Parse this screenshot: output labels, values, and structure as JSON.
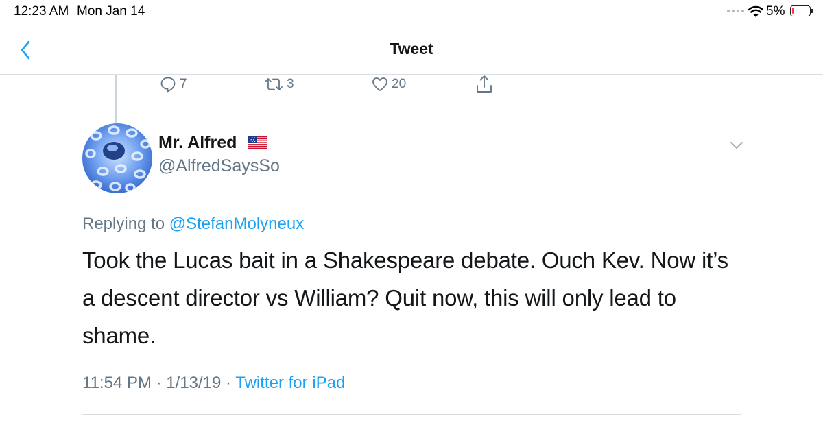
{
  "status_bar": {
    "time": "12:23 AM",
    "date": "Mon Jan 14",
    "battery": "5%"
  },
  "nav": {
    "title": "Tweet"
  },
  "actions": {
    "replies": "7",
    "retweets": "3",
    "likes": "20"
  },
  "author": {
    "name": "Mr. Alfred",
    "flag": "🇺🇸",
    "handle": "@AlfredSaysSo"
  },
  "tweet": {
    "replying_prefix": "Replying to",
    "replying_to": "@StefanMolyneux",
    "text": "Took the Lucas bait in a Shakespeare debate. Ouch Kev. Now it’s a descent director vs William? Quit now, this will only lead to shame.",
    "time": "11:54 PM",
    "date": "1/13/19",
    "source": "Twitter for iPad"
  },
  "colors": {
    "accent": "#1da1f2",
    "secondary_text": "#657786",
    "primary_text": "#14171a",
    "battery_low": "#ff3b30"
  },
  "icons": {
    "back": "chevron-left-icon",
    "wifi": "wifi-icon",
    "reply": "speech-bubble-icon",
    "retweet": "retweet-icon",
    "like": "heart-icon",
    "share": "share-icon",
    "more": "chevron-down-icon"
  }
}
